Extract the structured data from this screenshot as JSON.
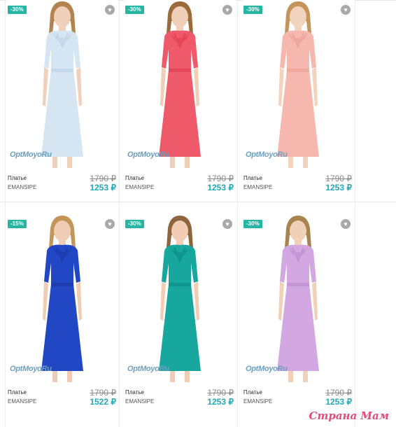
{
  "products": [
    {
      "badge": "-30%",
      "name": "Платье",
      "brand": "EMANSIPE",
      "old_price": "1790 ₽",
      "new_price": "1253 ₽",
      "logo": "OptMoyoRu",
      "dress_color": "#d5e5f2",
      "ruffle_color": "#c5d9ea",
      "skin": "#f0d0bb",
      "hair": "#b0834f"
    },
    {
      "badge": "-30%",
      "name": "Платье",
      "brand": "EMANSIPE",
      "old_price": "1790 ₽",
      "new_price": "1253 ₽",
      "logo": "OptMoyoRu",
      "dress_color": "#ee5a6a",
      "ruffle_color": "#e5475a",
      "skin": "#f0cfb8",
      "hair": "#9b6a3c"
    },
    {
      "badge": "-30%",
      "name": "Платье",
      "brand": "EMANSIPE",
      "old_price": "1790 ₽",
      "new_price": "1253 ₽",
      "logo": "OptMoyoRu",
      "dress_color": "#f6b8ae",
      "ruffle_color": "#efa89d",
      "skin": "#f2d3bd",
      "hair": "#c4955a"
    },
    {
      "badge": "-15%",
      "name": "Платье",
      "brand": "EMANSIPE",
      "old_price": "1790 ₽",
      "new_price": "1522 ₽",
      "logo": "OptMoyoRu",
      "dress_color": "#2247c4",
      "ruffle_color": "#1c3cb0",
      "skin": "#efcdb5",
      "hair": "#c49558"
    },
    {
      "badge": "-30%",
      "name": "Платье",
      "brand": "EMANSIPE",
      "old_price": "1790 ₽",
      "new_price": "1253 ₽",
      "logo": "OptMoyoRu",
      "dress_color": "#17a79e",
      "ruffle_color": "#0f958c",
      "skin": "#f0cdb4",
      "hair": "#8e643c"
    },
    {
      "badge": "-30%",
      "name": "Платье",
      "brand": "EMANSIPE",
      "old_price": "1790 ₽",
      "new_price": "1253 ₽",
      "logo": "OptMoyoRu",
      "dress_color": "#d3a7e2",
      "ruffle_color": "#c596d6",
      "skin": "#f1d0b8",
      "hair": "#a9834f"
    }
  ],
  "watermark": "Страна Мам",
  "icons": {
    "favorite": "heart-icon"
  }
}
